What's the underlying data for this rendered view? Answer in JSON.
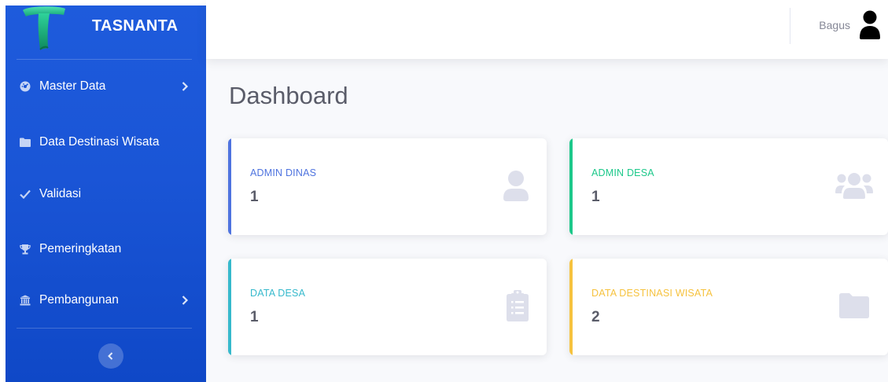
{
  "brand": {
    "name": "TASNANTA",
    "logo_icon": "tasnanta-logo-icon"
  },
  "sidebar": {
    "items": [
      {
        "label": "Master Data",
        "icon": "tachometer-icon",
        "has_chevron": true
      },
      {
        "label": "Data Destinasi Wisata",
        "icon": "folder-icon",
        "has_chevron": false
      },
      {
        "label": "Validasi",
        "icon": "check-icon",
        "has_chevron": false
      },
      {
        "label": "Pemeringkatan",
        "icon": "trophy-icon",
        "has_chevron": false
      },
      {
        "label": "Pembangunan",
        "icon": "landmark-icon",
        "has_chevron": true
      }
    ],
    "toggle_icon": "chevron-left-icon"
  },
  "topbar": {
    "user_name": "Bagus",
    "avatar_icon": "user-icon"
  },
  "main": {
    "title": "Dashboard",
    "cards": [
      {
        "label": "ADMIN DINAS",
        "value": "1",
        "accent": "#4e73df",
        "icon": "user-icon"
      },
      {
        "label": "ADMIN DESA",
        "value": "1",
        "accent": "#1cc88a",
        "icon": "users-icon"
      },
      {
        "label": "DATA DESA",
        "value": "1",
        "accent": "#36b9cc",
        "icon": "clipboard-list-icon"
      },
      {
        "label": "DATA DESTINASI WISATA",
        "value": "2",
        "accent": "#f6c23e",
        "icon": "folder-icon"
      }
    ]
  },
  "colors": {
    "sidebar_bg": "#1a55d6",
    "content_bg": "#f8f9fc",
    "title_text": "#5a5c69",
    "muted_icon": "#dddfeb"
  }
}
